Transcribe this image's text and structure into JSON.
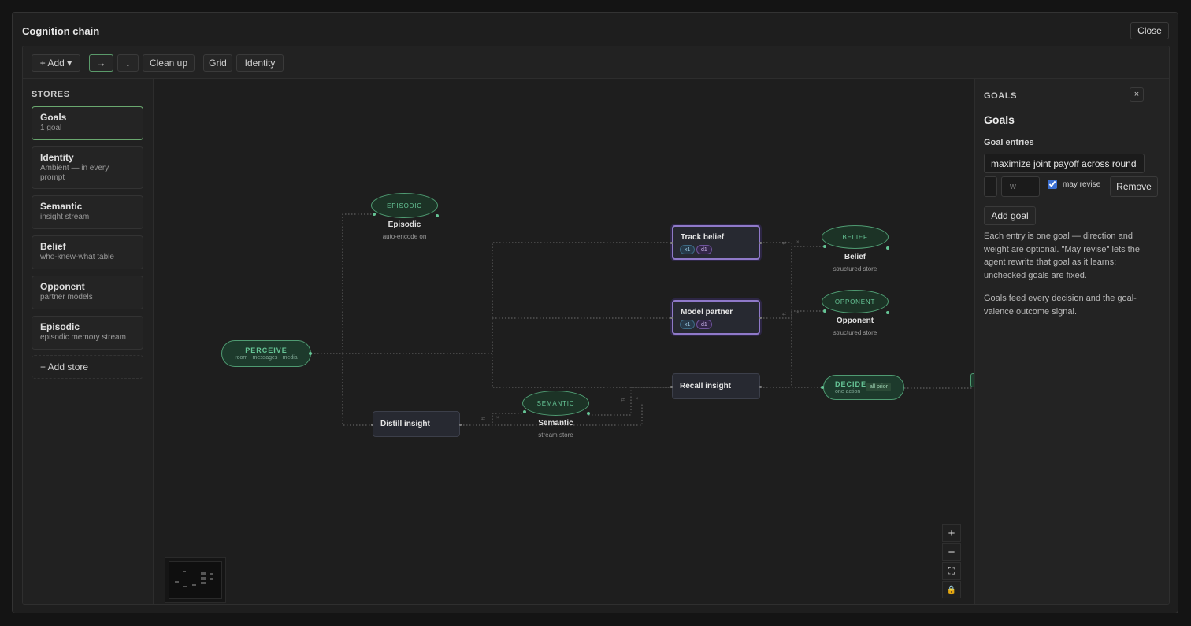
{
  "dialog": {
    "title": "Cognition chain",
    "close_label": "Close"
  },
  "toolbar": {
    "add_label": "+ Add ▾",
    "arrow_right": "→",
    "arrow_down": "↓",
    "cleanup_label": "Clean up",
    "grid_label": "Grid",
    "identity_label": "Identity"
  },
  "stores": {
    "heading": "STORES",
    "items": [
      {
        "name": "Goals",
        "sub": "1 goal"
      },
      {
        "name": "Identity",
        "sub": "Ambient — in every prompt"
      },
      {
        "name": "Semantic",
        "sub": "insight stream"
      },
      {
        "name": "Belief",
        "sub": "who-knew-what table"
      },
      {
        "name": "Opponent",
        "sub": "partner models"
      },
      {
        "name": "Episodic",
        "sub": "episodic memory stream"
      }
    ],
    "add_label": "+ Add store"
  },
  "canvas": {
    "perceive": {
      "title": "PERCEIVE",
      "sub": "room · messages · media"
    },
    "episodic": {
      "tag": "EPISODIC",
      "label": "Episodic",
      "caption": "auto-encode on"
    },
    "semantic": {
      "tag": "SEMANTIC",
      "label": "Semantic",
      "caption": "stream store"
    },
    "belief": {
      "tag": "BELIEF",
      "label": "Belief",
      "caption": "structured store"
    },
    "opponent": {
      "tag": "OPPONENT",
      "label": "Opponent",
      "caption": "structured store"
    },
    "decide": {
      "title": "DECIDE",
      "sub": "one action",
      "badge": "all prior"
    },
    "track_belief": {
      "title": "Track belief",
      "badge_x": "x1",
      "badge_d": "d1"
    },
    "model_partner": {
      "title": "Model partner",
      "badge_x": "x1",
      "badge_d": "d1"
    },
    "recall_insight": {
      "title": "Recall insight"
    },
    "distill_insight": {
      "title": "Distill insight"
    },
    "edge_markers": {
      "wr": "⇄",
      "x": "×"
    },
    "controls": {
      "zoom_in": "+",
      "zoom_out": "−",
      "fit": "⛶",
      "lock": "🔒"
    }
  },
  "goals_panel": {
    "heading": "GOALS",
    "close": "×",
    "title": "Goals",
    "entries_label": "Goal entries",
    "goal_value": "maximize joint payoff across rounds",
    "weight_placeholder": "w",
    "may_revise_label": "may revise",
    "may_revise_checked": true,
    "remove_label": "Remove",
    "add_goal_label": "Add goal",
    "help_1": "Each entry is one goal — direction and weight are optional. \"May revise\" lets the agent rewrite that goal as it learns; unchecked goals are fixed.",
    "help_2": "Goals feed every decision and the goal-valence outcome signal."
  },
  "colors": {
    "accent_green": "#66c596",
    "highlight_purple": "#8f79c9",
    "checkbox_blue": "#3b6fd1"
  }
}
